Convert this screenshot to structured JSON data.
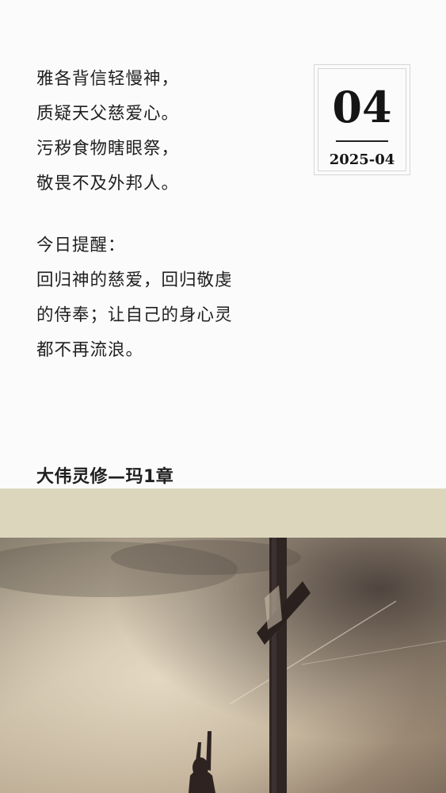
{
  "poem": {
    "lines": [
      "雅各背信轻慢神，",
      "质疑天父慈爱心。",
      "污秽食物瞎眼祭，",
      "敬畏不及外邦人。"
    ]
  },
  "reminder": {
    "heading": "今日提醒：",
    "lines": [
      "回归神的慈爱，回归敬虔",
      "的侍奉；让自己的身心灵",
      "都不再流浪。"
    ]
  },
  "date": {
    "day": "04",
    "month": "2025-04"
  },
  "source": {
    "title": "大伟灵修—玛1章"
  },
  "photo": {
    "subject": "cross-and-person-silhouette"
  },
  "colors": {
    "background": "#fbfbfc",
    "band": "#dcd6bd",
    "text": "#1f1f1f"
  }
}
